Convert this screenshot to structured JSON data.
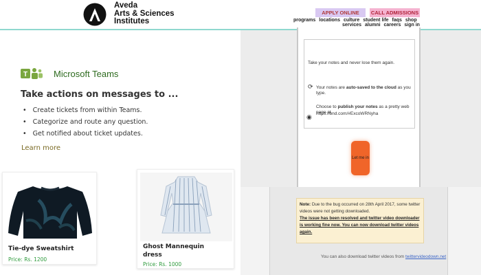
{
  "header": {
    "brand_line1": "Aveda",
    "brand_line2": "Arts & Sciences",
    "brand_line3": "Institutes",
    "apply_label": "APPLY ONLINE",
    "admissions_label": "CALL ADMISSIONS",
    "nav_row1": [
      "programs",
      "locations",
      "culture",
      "student life",
      "faqs",
      "shop"
    ],
    "nav_row2": [
      "services",
      "alumni",
      "careers",
      "sign in"
    ],
    "logo_icon": "aveda-a-logo",
    "accent_color": "#8fd8cf"
  },
  "teams": {
    "app_name": "Microsoft Teams",
    "logo_icon": "microsoft-teams-logo",
    "title": "Take actions on messages to ...",
    "bullets": [
      "Create tickets from within Teams.",
      "Categorize and route any question.",
      "Get notified about ticket updates."
    ],
    "learn_more": "Learn more"
  },
  "products": [
    {
      "name": "Tie-dye Sweatshirt",
      "price": "Price: Rs. 1200",
      "image_icon": "sweatshirt-image"
    },
    {
      "name": "Ghost Mannequin dress",
      "price": "Price: Rs. 1000",
      "image_icon": "dress-image"
    }
  ],
  "notes_panel": {
    "line1": "Take your notes and never lose them again.",
    "line2_a": "Your notes are ",
    "line2_b": "auto-saved to the cloud",
    "line2_c": " as you type.",
    "line3_a": "Choose to ",
    "line3_b": "publish your notes",
    "line3_c": " as a pretty web page at",
    "line4": "https://bnd.com/#ExcoWRNyha",
    "button_label": "Let me in quick!"
  },
  "twitter_panel": {
    "note_label": "Note:",
    "note_text": " Due to the bug occurred on 28th April 2017, some twitter videos were not getting downloaded.",
    "resolved_text": "The issue has been resolved and twitter video downloader is working fine now. You can now download twitter videos again.",
    "footer_text": "You can also download twitter videos from ",
    "footer_link": "twittervideodown.net"
  }
}
